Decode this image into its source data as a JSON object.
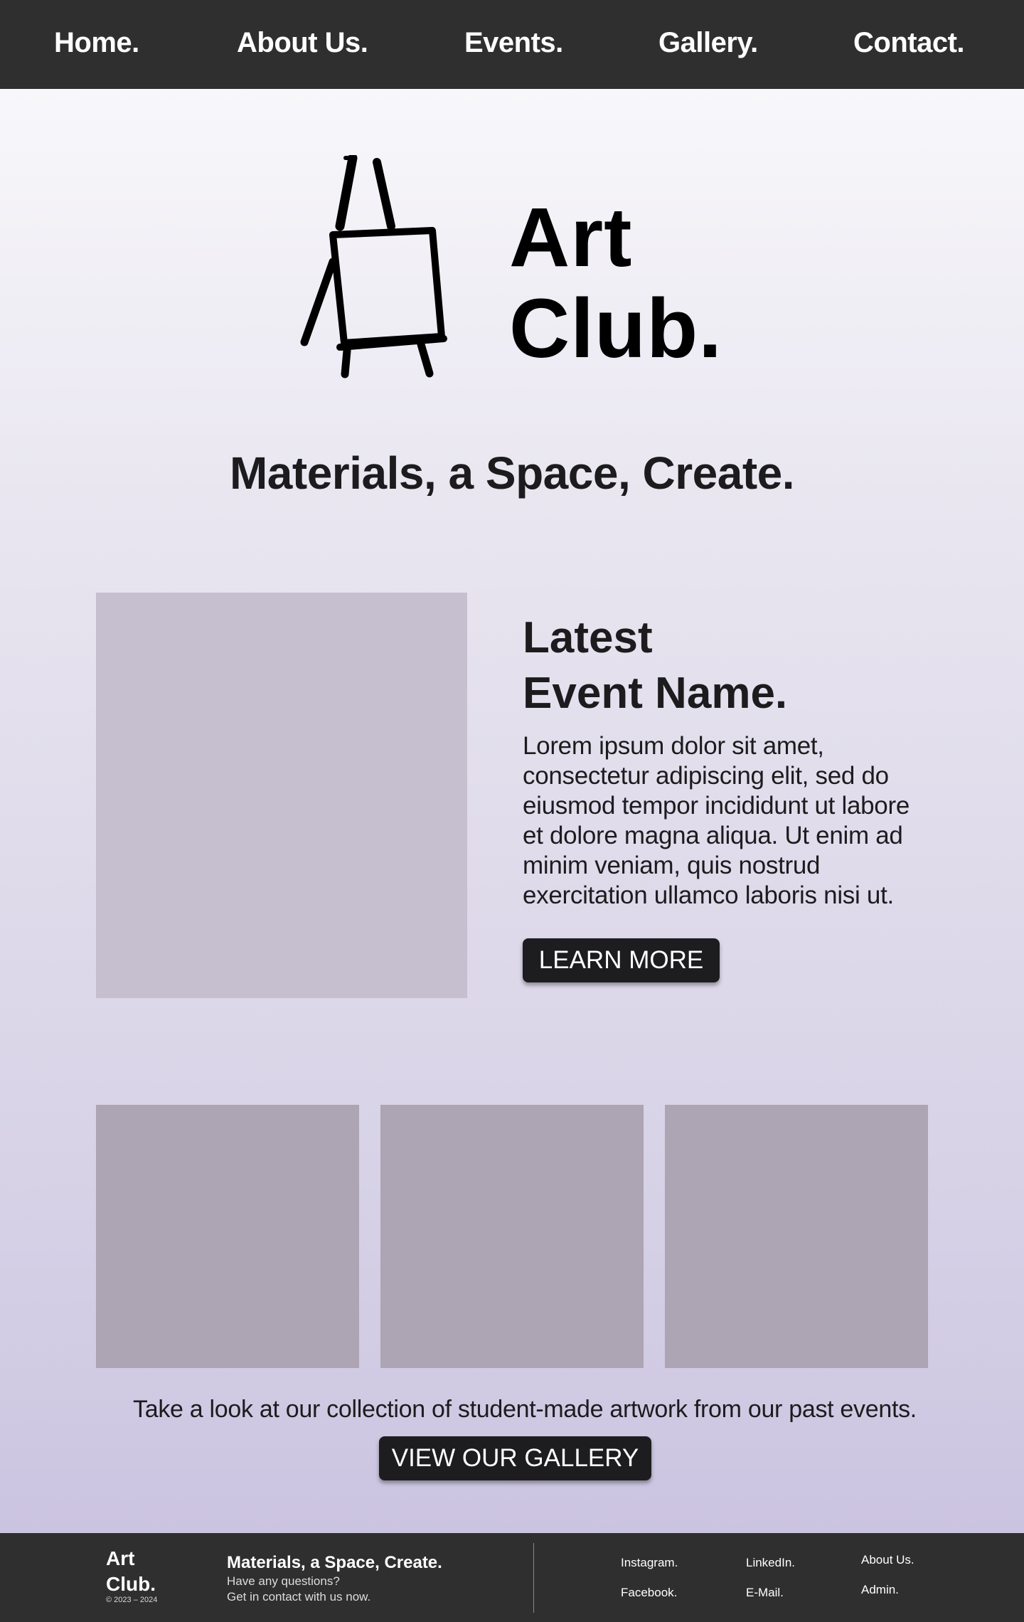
{
  "nav": {
    "items": [
      {
        "label": "Home."
      },
      {
        "label": "About Us."
      },
      {
        "label": "Events."
      },
      {
        "label": "Gallery."
      },
      {
        "label": "Contact."
      }
    ]
  },
  "hero": {
    "logo_line1": "Art",
    "logo_line2": "Club.",
    "logo_icon": "easel-icon",
    "tagline": "Materials, a Space, Create."
  },
  "event": {
    "title_line1": "Latest",
    "title_line2": "Event Name.",
    "description": "Lorem ipsum dolor sit amet, consectetur adipiscing elit, sed do eiusmod tempor incididunt ut labore et dolore magna aliqua. Ut enim ad minim veniam, quis nostrud exercitation ullamco laboris nisi ut.",
    "button_label": "LEARN MORE"
  },
  "gallery": {
    "text": "Take a look at our collection of student-made artwork from our past events.",
    "button_label": "VIEW OUR GALLERY"
  },
  "footer": {
    "brand_line1": "Art",
    "brand_line2": "Club.",
    "copyright": "© 2023 – 2024",
    "tagline": "Materials, a Space, Create.",
    "question": "Have any questions?",
    "contact": "Get in contact with us now.",
    "links": {
      "instagram": "Instagram.",
      "facebook": "Facebook.",
      "linkedin": "LinkedIn.",
      "email": "E-Mail.",
      "about": "About Us.",
      "admin": "Admin."
    }
  },
  "colors": {
    "nav_bg": "#2f2f30",
    "button_bg": "#1d1d1f",
    "event_placeholder": "#c5bfcf",
    "gallery_placeholder": "#ada4b4"
  }
}
